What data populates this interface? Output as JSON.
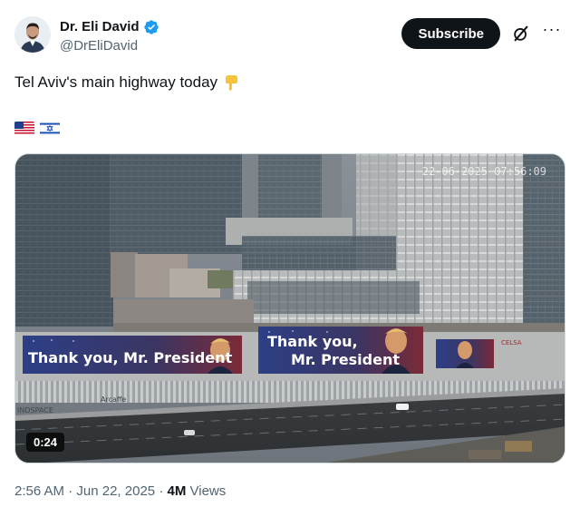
{
  "author": {
    "name": "Dr. Eli David",
    "handle": "@DrEliDavid",
    "verified": true
  },
  "actions": {
    "subscribe_label": "Subscribe",
    "grok_icon": "grok-icon",
    "more_icon": "more-icon"
  },
  "tweet": {
    "text": "Tel Aviv's main highway today",
    "emoji": "pointing-down-emoji",
    "flags": [
      "us-flag",
      "israel-flag"
    ]
  },
  "media": {
    "camera_timestamp": "22-06-2025 07:56:09",
    "duration": "0:24",
    "billboard_1": "Thank you, Mr. President",
    "billboard_2_line1": "Thank you,",
    "billboard_2_line2": "Mr. President",
    "sign_left": "INDSPACE",
    "sign_mid": "Arcaffe",
    "sign_right": "CELSA"
  },
  "meta": {
    "time": "2:56 AM",
    "date": "Jun 22, 2025",
    "views_count": "4M",
    "views_label": "Views"
  },
  "colors": {
    "text": "#0f1419",
    "secondary": "#536471",
    "verified_blue": "#1d9bf0"
  }
}
